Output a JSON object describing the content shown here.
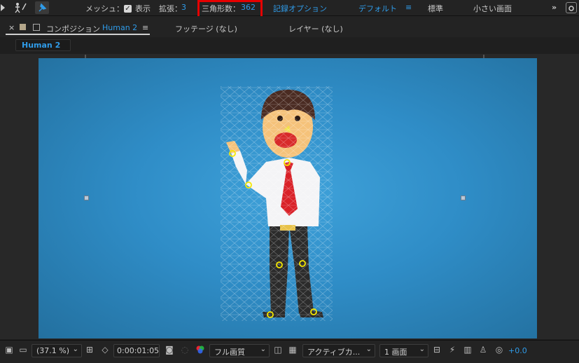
{
  "toolbar": {
    "mesh_label": "メッシュ：",
    "show_label": "表示",
    "expand_label": "拡張：",
    "expand_value": "3",
    "triangles_label": "三角形数：",
    "triangles_value": "362",
    "record_options": "記録オプション",
    "workspace_default": "デフォルト",
    "workspace_menu_icon": "≡",
    "workspace_standard": "標準",
    "workspace_small": "小さい画面",
    "more": "»"
  },
  "panel": {
    "close": "×",
    "comp_label": "コンポジション",
    "comp_name": "Human 2",
    "menu_icon": "≡",
    "footage_tab": "フッテージ (なし)",
    "layer_tab": "レイヤー (なし)",
    "breadcrumb": "Human 2"
  },
  "bottom": {
    "zoom": "(37.1 %)",
    "timecode": "0:00:01:05",
    "resolution": "フル画質",
    "camera": "アクティブカ...",
    "views": "1 画面",
    "exposure": "+0.0"
  },
  "colors": {
    "accent": "#2f9be8",
    "highlight": "#e50000",
    "canvas": "#2f8dc7"
  }
}
